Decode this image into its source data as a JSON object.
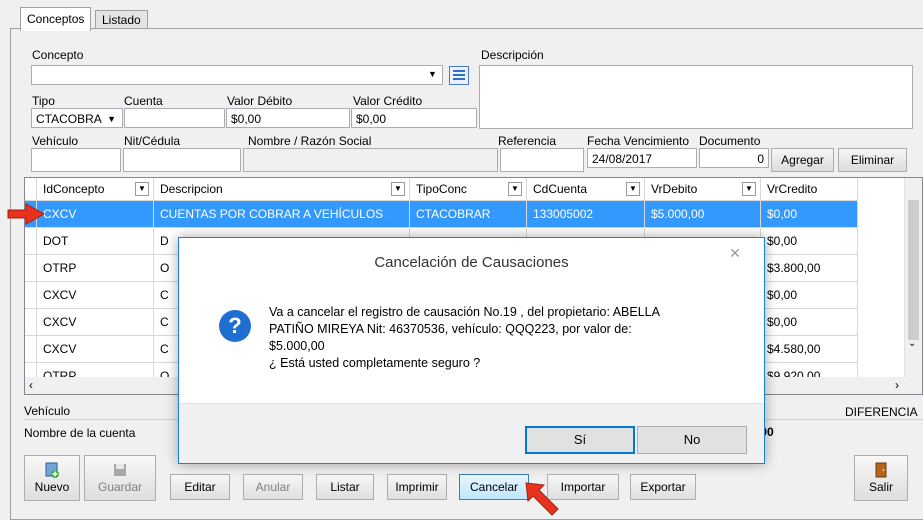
{
  "tabs": [
    {
      "label": "Conceptos"
    },
    {
      "label": "Listado"
    }
  ],
  "form": {
    "concepto_label": "Concepto",
    "descripcion_label": "Descripción",
    "tipo_label": "Tipo",
    "tipo_value": "CTACOBRA",
    "cuenta_label": "Cuenta",
    "valor_debito_label": "Valor Débito",
    "valor_debito_value": "$0,00",
    "valor_credito_label": "Valor Crédito",
    "valor_credito_value": "$0,00",
    "vehiculo_label": "Vehículo",
    "nit_label": "Nit/Cédula",
    "nombre_label": "Nombre / Razón Social",
    "referencia_label": "Referencia",
    "fecha_label": "Fecha Vencimiento",
    "fecha_value": "24/08/2017",
    "documento_label": "Documento",
    "documento_value": "0",
    "agregar_label": "Agregar",
    "eliminar_label": "Eliminar"
  },
  "grid": {
    "columns": [
      {
        "label": "IdConcepto"
      },
      {
        "label": "Descripcion"
      },
      {
        "label": "TipoConc"
      },
      {
        "label": "CdCuenta"
      },
      {
        "label": "VrDebito"
      },
      {
        "label": "VrCredito"
      }
    ],
    "rows": [
      {
        "c": [
          "CXCV",
          "CUENTAS POR COBRAR A VEHÍCULOS",
          "CTACOBRAR",
          "133005002",
          "$5.000,00",
          "$0,00"
        ]
      },
      {
        "c": [
          "DOT",
          "D",
          "",
          "",
          "",
          "$0,00"
        ]
      },
      {
        "c": [
          "OTRP",
          "O",
          "",
          "",
          "",
          "$3.800,00"
        ]
      },
      {
        "c": [
          "CXCV",
          "C",
          "",
          "",
          "",
          "$0,00"
        ]
      },
      {
        "c": [
          "CXCV",
          "C",
          "",
          "",
          "",
          "$0,00"
        ]
      },
      {
        "c": [
          "CXCV",
          "C",
          "",
          "",
          "",
          "$4.580,00"
        ]
      },
      {
        "c": [
          "OTRP",
          "O",
          "",
          "",
          "",
          "$9.920,00"
        ]
      }
    ]
  },
  "footer": {
    "vehiculo_label": "Vehículo",
    "diferencia_label": "DIFERENCIA",
    "nombre_cuenta_label": "Nombre de la cuenta",
    "diferencia_value": ",00"
  },
  "dialog": {
    "title": "Cancelación de Causaciones",
    "line1": "Va a cancelar el registro de causación No.19 , del propietario: ABELLA",
    "line2": "PATIÑO MIREYA Nit: 46370536, vehículo: QQQ223, por valor de:",
    "line3": "$5.000,00",
    "line4": "¿ Está usted completamente seguro ?",
    "yes_label": "Sí",
    "no_label": "No"
  },
  "toolbar": [
    {
      "label": "Nuevo"
    },
    {
      "label": "Guardar"
    },
    {
      "label": "Editar"
    },
    {
      "label": "Anular"
    },
    {
      "label": "Listar"
    },
    {
      "label": "Imprimir"
    },
    {
      "label": "Cancelar"
    },
    {
      "label": "Importar"
    },
    {
      "label": "Exportar"
    },
    {
      "label": "Salir"
    }
  ],
  "colors": {
    "selection": "#3399ff",
    "dialog_border": "#1883d7",
    "annotation_arrow": "#e8321e",
    "question_icon": "#1e6fd0"
  }
}
